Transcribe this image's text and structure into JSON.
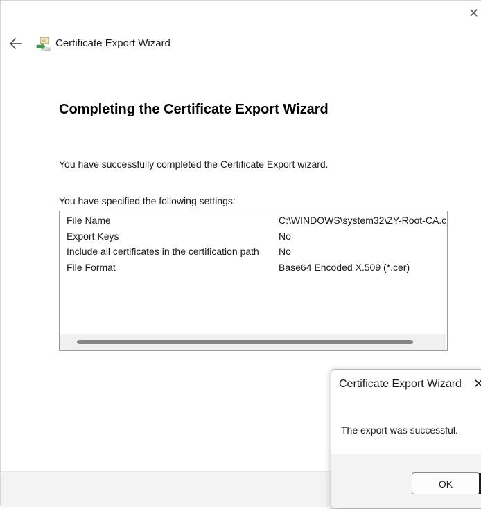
{
  "wizard": {
    "title": "Certificate Export Wizard",
    "close_glyph": "✕",
    "heading": "Completing the Certificate Export Wizard",
    "success_message": "You have successfully completed the Certificate Export wizard.",
    "settings_label": "You have specified the following settings:",
    "settings": [
      {
        "key": "File Name",
        "value": "C:\\WINDOWS\\system32\\ZY-Root-CA.c"
      },
      {
        "key": "Export Keys",
        "value": "No"
      },
      {
        "key": "Include all certificates in the certification path",
        "value": "No"
      },
      {
        "key": "File Format",
        "value": "Base64 Encoded X.509 (*.cer)"
      }
    ]
  },
  "message_box": {
    "title": "Certificate Export Wizard",
    "close_glyph": "✕",
    "text": "The export was successful.",
    "ok_label": "OK"
  },
  "icons": {
    "back": "back-arrow-icon",
    "wizard": "certificate-icon",
    "close": "close-icon"
  },
  "colors": {
    "background": "#ffffff",
    "footer": "#f3f3f3",
    "border": "#9a9a9a",
    "scroll_thumb": "#858585"
  }
}
